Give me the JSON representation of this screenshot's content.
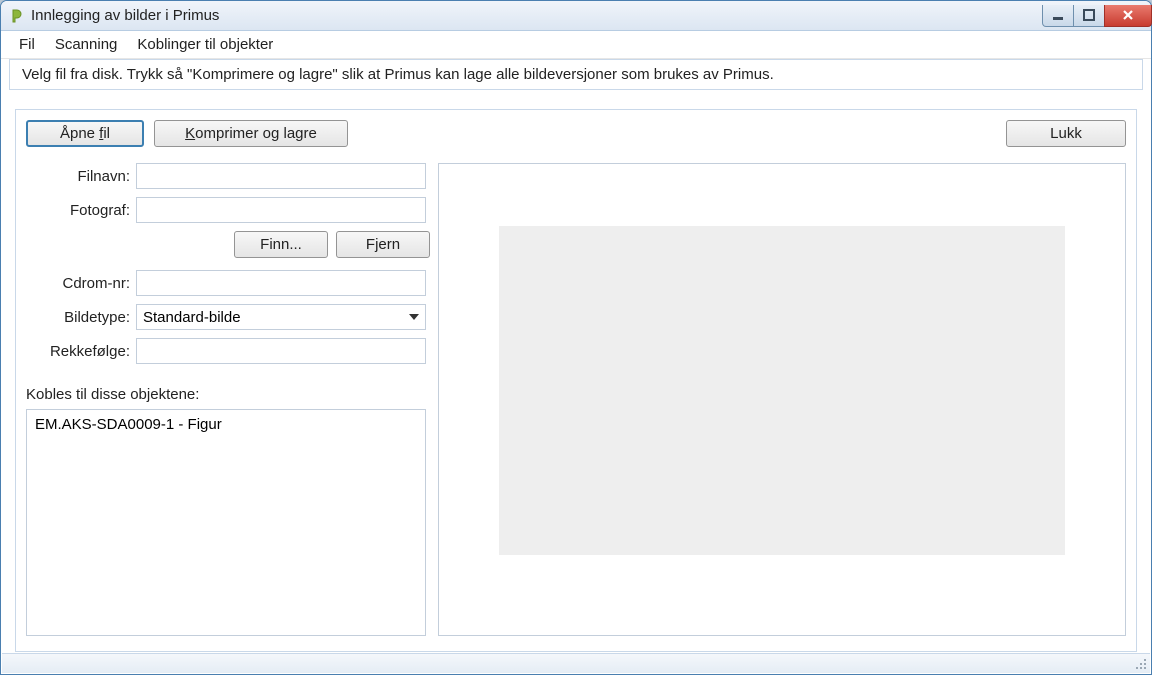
{
  "window": {
    "title": "Innlegging av bilder i Primus"
  },
  "menu": {
    "fil": "Fil",
    "scanning": "Scanning",
    "koblinger": "Koblinger til objekter"
  },
  "info_text": "Velg fil fra disk. Trykk så \"Komprimere og lagre\" slik at Primus kan lage alle bildeversjoner som brukes av Primus.",
  "buttons": {
    "open_file": "Åpne fil",
    "compress_save": "Komprimer og lagre",
    "close": "Lukk",
    "find": "Finn...",
    "remove": "Fjern"
  },
  "labels": {
    "filnavn": "Filnavn:",
    "fotograf": "Fotograf:",
    "cdrom": "Cdrom-nr:",
    "bildetype": "Bildetype:",
    "rekkefolge": "Rekkefølge:",
    "kobles": "Kobles til disse objektene:"
  },
  "fields": {
    "filnavn": "",
    "fotograf": "",
    "cdrom": "",
    "bildetype_selected": "Standard-bilde",
    "rekkefolge": ""
  },
  "objects_list": [
    "EM.AKS-SDA0009-1 - Figur"
  ]
}
